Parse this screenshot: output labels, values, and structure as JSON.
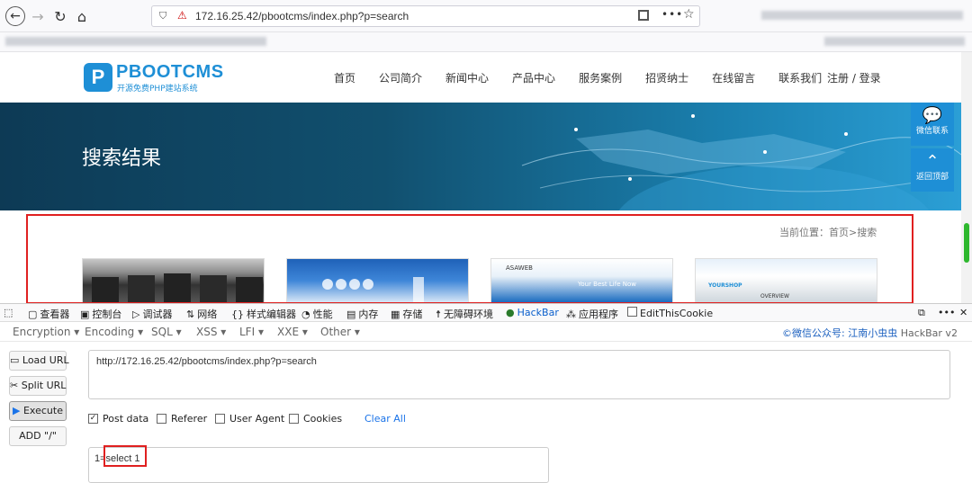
{
  "browser": {
    "url": "172.16.25.42/pbootcms/index.php?p=search",
    "more_label": "•••",
    "star_label": "☆"
  },
  "site": {
    "logo_text": "PBOOTCMS",
    "logo_sub": "开源免费PHP建站系统",
    "nav": [
      "首页",
      "公司简介",
      "新闻中心",
      "产品中心",
      "服务案例",
      "招贤纳士",
      "在线留言",
      "联系我们"
    ],
    "login": "注册 / 登录",
    "banner_title": "搜索结果",
    "breadcrumb": "当前位置：首页>搜索",
    "side_wechat": "微信联系",
    "side_top": "返回顶部",
    "thumb_labels": [
      "ASAWEB",
      "Your Best Life Now",
      "YOURSHOP",
      "OVERVIEW"
    ]
  },
  "devtools": {
    "tabs": [
      "查看器",
      "控制台",
      "调试器",
      "网络",
      "样式编辑器",
      "性能",
      "内存",
      "存储",
      "无障碍环境",
      "HackBar",
      "应用程序",
      "EditThisCookie"
    ]
  },
  "hackbar": {
    "menu": [
      "Encryption ▾",
      "Encoding ▾",
      "SQL ▾",
      "XSS ▾",
      "LFI ▾",
      "XXE ▾",
      "Other ▾"
    ],
    "credit_prefix": "©微信公众号: 江南小虫虫",
    "credit_suffix": " HackBar v2",
    "buttons": {
      "load": "Load URL",
      "split": "Split URL",
      "execute": "Execute",
      "add": "ADD \"/\""
    },
    "url_value": "http://172.16.25.42/pbootcms/index.php?p=search",
    "options": {
      "post_data": "Post data",
      "referer": "Referer",
      "user_agent": "User Agent",
      "cookies": "Cookies",
      "clear_all": "Clear All"
    },
    "post_value": "1=select 1",
    "post_checked": true
  },
  "colors": {
    "accent": "#1e8fd6",
    "highlight": "#e02020",
    "link": "#1a73e8"
  }
}
